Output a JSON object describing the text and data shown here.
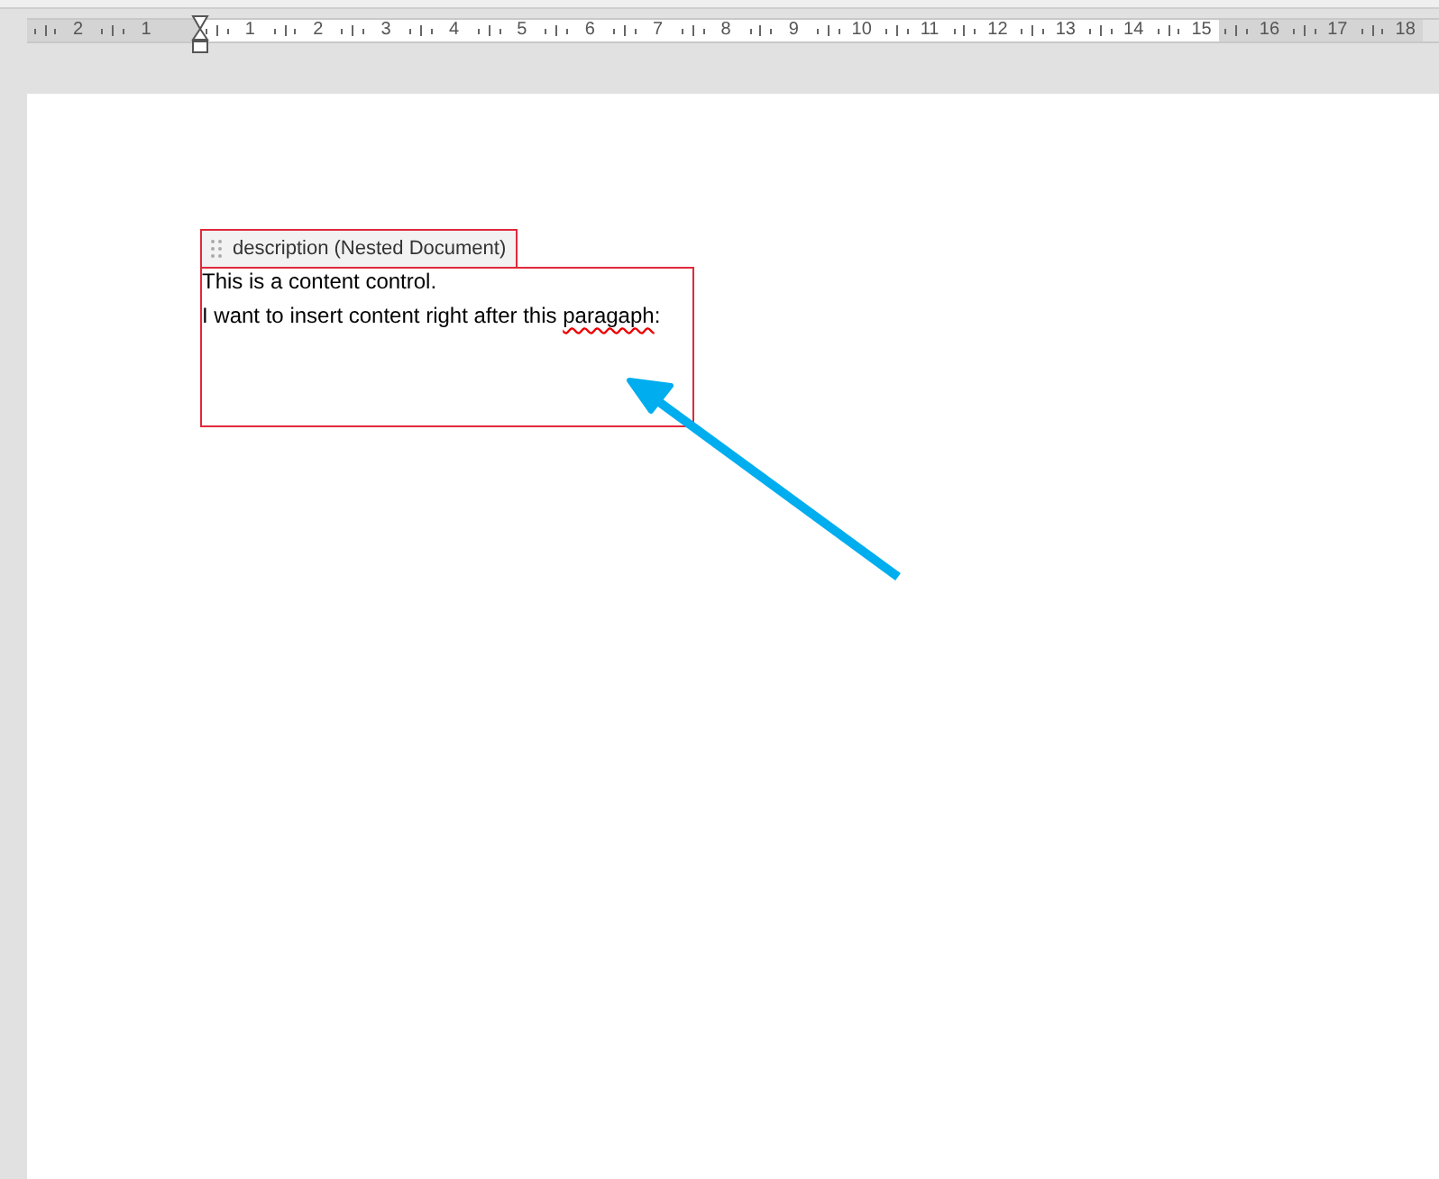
{
  "ruler": {
    "left_margin_labels": [
      "2",
      "1"
    ],
    "labels": [
      "1",
      "2",
      "3",
      "4",
      "5",
      "6",
      "7",
      "8",
      "9",
      "10",
      "11",
      "12",
      "13",
      "14",
      "15"
    ],
    "right_margin_labels": [
      "16",
      "17",
      "18"
    ]
  },
  "content_control": {
    "tag": "description (Nested Document)",
    "paragraphs": [
      {
        "text": "This is a content control."
      },
      {
        "text": "I want to insert content right after this ",
        "misspelled_word": "paragaph",
        "trailing_text": ":"
      }
    ]
  },
  "annotation": {
    "kind": "arrow",
    "color": "#00aeef"
  }
}
